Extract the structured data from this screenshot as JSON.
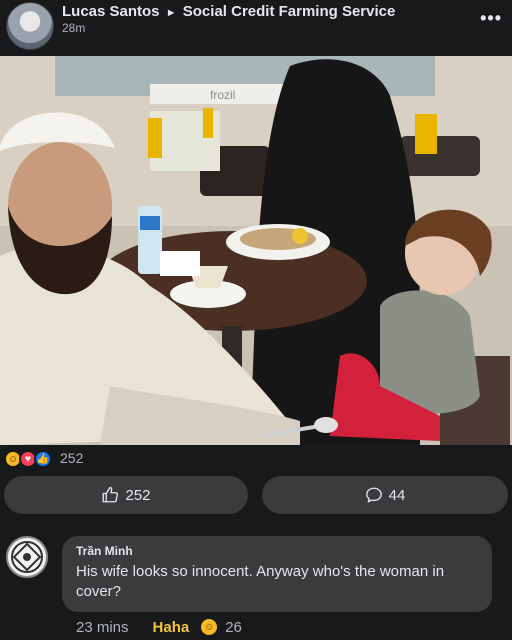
{
  "post": {
    "author": "Lucas Santos",
    "arrow": "►",
    "group": "Social Credit Farming Service",
    "time": "28m",
    "more_icon": "•••"
  },
  "photo": {
    "cafe_sign": "frozil"
  },
  "reactions": {
    "icons": [
      "haha-icon",
      "love-icon",
      "like-icon"
    ],
    "count": "252"
  },
  "actions": {
    "like_label": "252",
    "comment_label": "44"
  },
  "comment": {
    "author": "Trần Minh",
    "text": "His wife looks so innocent. Anyway who's the woman in cover?",
    "time": "23 mins",
    "haha_label": "Haha",
    "reaction_count": "26"
  },
  "colors": {
    "background": "#18191a",
    "surface": "#3a3b3c",
    "text": "#e4e6eb",
    "muted": "#b0b3b8",
    "haha": "#f5c33b"
  }
}
